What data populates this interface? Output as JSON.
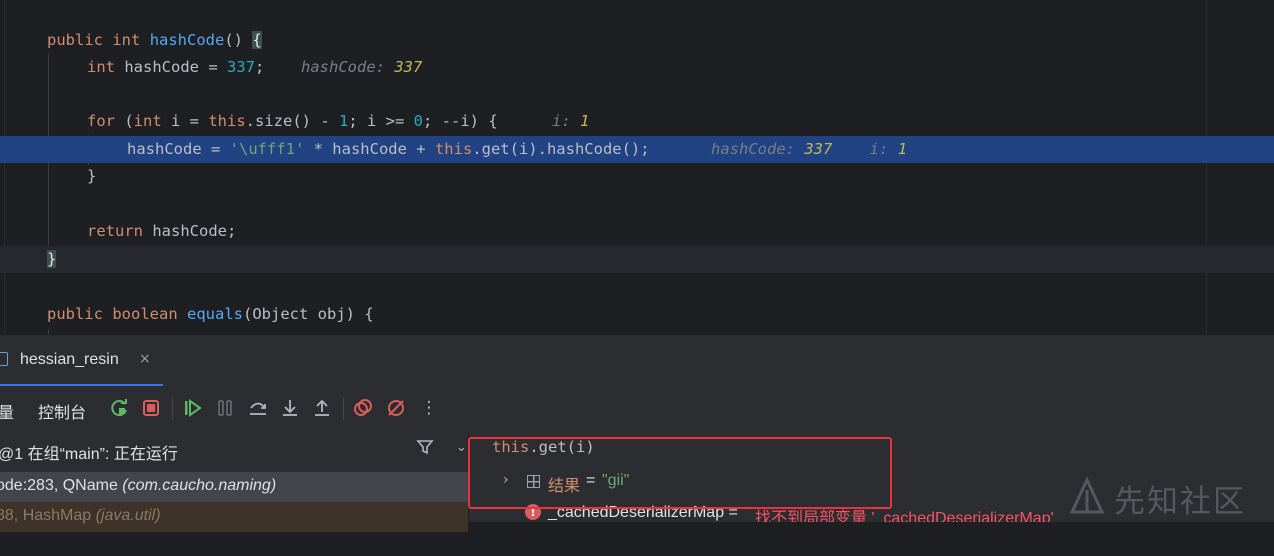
{
  "editor": {
    "lines": [
      {
        "tokens": [
          [
            "kw",
            "public"
          ],
          [
            "p",
            " "
          ],
          [
            "kw",
            "int"
          ],
          [
            "p",
            " "
          ],
          [
            "fn",
            "hashCode"
          ],
          [
            "p",
            "() "
          ],
          [
            "brace",
            "{"
          ]
        ]
      },
      {
        "tokens": [
          [
            "kw",
            "int"
          ],
          [
            "p",
            " hashCode = "
          ],
          [
            "num",
            "337"
          ],
          [
            "p",
            ";"
          ]
        ],
        "hint": [
          {
            "name": "hashCode:",
            "value": "337"
          }
        ]
      },
      {
        "tokens": []
      },
      {
        "tokens": [
          [
            "kw",
            "for"
          ],
          [
            "p",
            " ("
          ],
          [
            "kw",
            "int"
          ],
          [
            "p",
            " i = "
          ],
          [
            "kw",
            "this"
          ],
          [
            "p",
            ".size() - "
          ],
          [
            "num",
            "1"
          ],
          [
            "p",
            "; i >= "
          ],
          [
            "num",
            "0"
          ],
          [
            "p",
            "; --i) {"
          ]
        ],
        "hint": [
          {
            "name": "i:",
            "value": "1"
          }
        ]
      },
      {
        "tokens": [
          [
            "p",
            "hashCode = "
          ],
          [
            "str",
            "'\\ufff1'"
          ],
          [
            "p",
            " * hashCode + "
          ],
          [
            "kw",
            "this"
          ],
          [
            "p",
            ".get(i).hashCode();"
          ]
        ],
        "hint": [
          {
            "name": "hashCode:",
            "value": "337"
          },
          {
            "name": "i:",
            "value": "1"
          }
        ]
      },
      {
        "tokens": [
          [
            "p",
            "}"
          ]
        ]
      },
      {
        "tokens": []
      },
      {
        "tokens": [
          [
            "kw",
            "return"
          ],
          [
            "p",
            " hashCode;"
          ]
        ]
      },
      {
        "tokens": [
          [
            "brace",
            "}"
          ]
        ]
      },
      {
        "tokens": []
      },
      {
        "tokens": [
          [
            "kw",
            "public"
          ],
          [
            "p",
            " "
          ],
          [
            "kw",
            "boolean"
          ],
          [
            "p",
            " "
          ],
          [
            "fn",
            "equals"
          ],
          [
            "p",
            "(Object obj) {"
          ]
        ]
      }
    ]
  },
  "debug": {
    "tab_label": "hessian_resin",
    "tab_close": "×",
    "toolbar": {
      "variables_label": "量",
      "console_label": "控制台",
      "more_icon": "⋮"
    },
    "thread_text": "@1 在组“main”: 正在运行",
    "frames": [
      {
        "name": "ode:283, QName ",
        "pkg": "(com.caucho.naming)"
      },
      {
        "name": "88, HashMap ",
        "pkg": "(java.util)"
      }
    ],
    "evaluate": {
      "expression_kw": "this",
      "expression_rest": ".get(i)",
      "result_name": "结果",
      "result_eq": "=",
      "result_value": "\"gii\"",
      "error_name": "_cachedDeserializerMap =",
      "error_message": "找不到局部变量 '_cachedDeserializerMap'"
    },
    "icons": {
      "rerun": "rerun-icon",
      "stop": "stop-icon",
      "resume": "resume-icon",
      "pause": "pause-icon",
      "step_over": "step-over-icon",
      "step_into": "step-into-icon",
      "step_out": "step-out-icon",
      "view_breakpoints": "view-breakpoints-icon",
      "mute_breakpoints": "mute-breakpoints-icon",
      "filter": "filter-icon"
    },
    "colors": {
      "accent": "#3574f0",
      "stop": "#db5c5c",
      "resume": "#5fb865",
      "error": "#f75464",
      "highlight": "#214283"
    }
  },
  "watermark": {
    "text": "先知社区"
  }
}
